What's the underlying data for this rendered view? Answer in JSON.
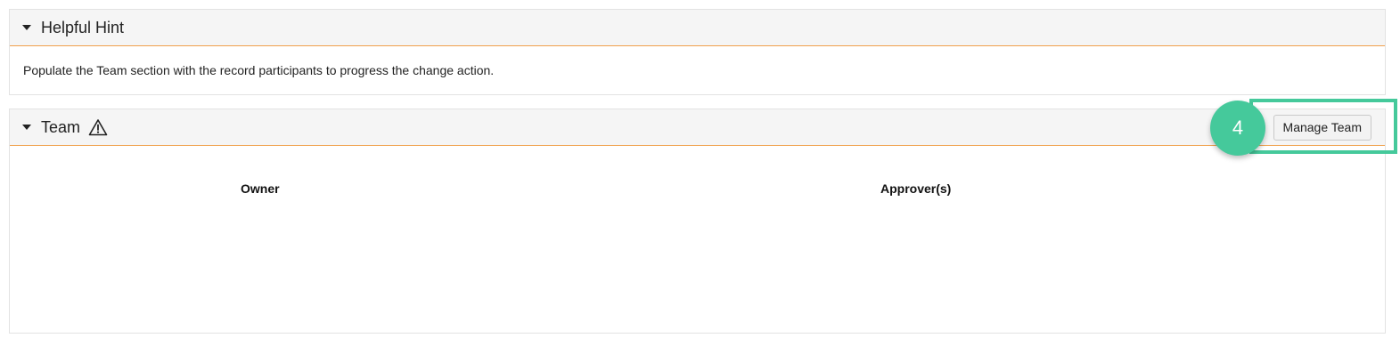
{
  "hint": {
    "title": "Helpful Hint",
    "message": "Populate the Team section with the record participants to progress the change action."
  },
  "team": {
    "title": "Team",
    "manage_button_label": "Manage Team",
    "columns": {
      "owner": "Owner",
      "approvers": "Approver(s)"
    }
  },
  "annotation": {
    "step_number": "4",
    "accent_color": "#45c99b"
  },
  "colors": {
    "header_underline": "#f0a04b",
    "header_bg": "#f5f5f5"
  }
}
